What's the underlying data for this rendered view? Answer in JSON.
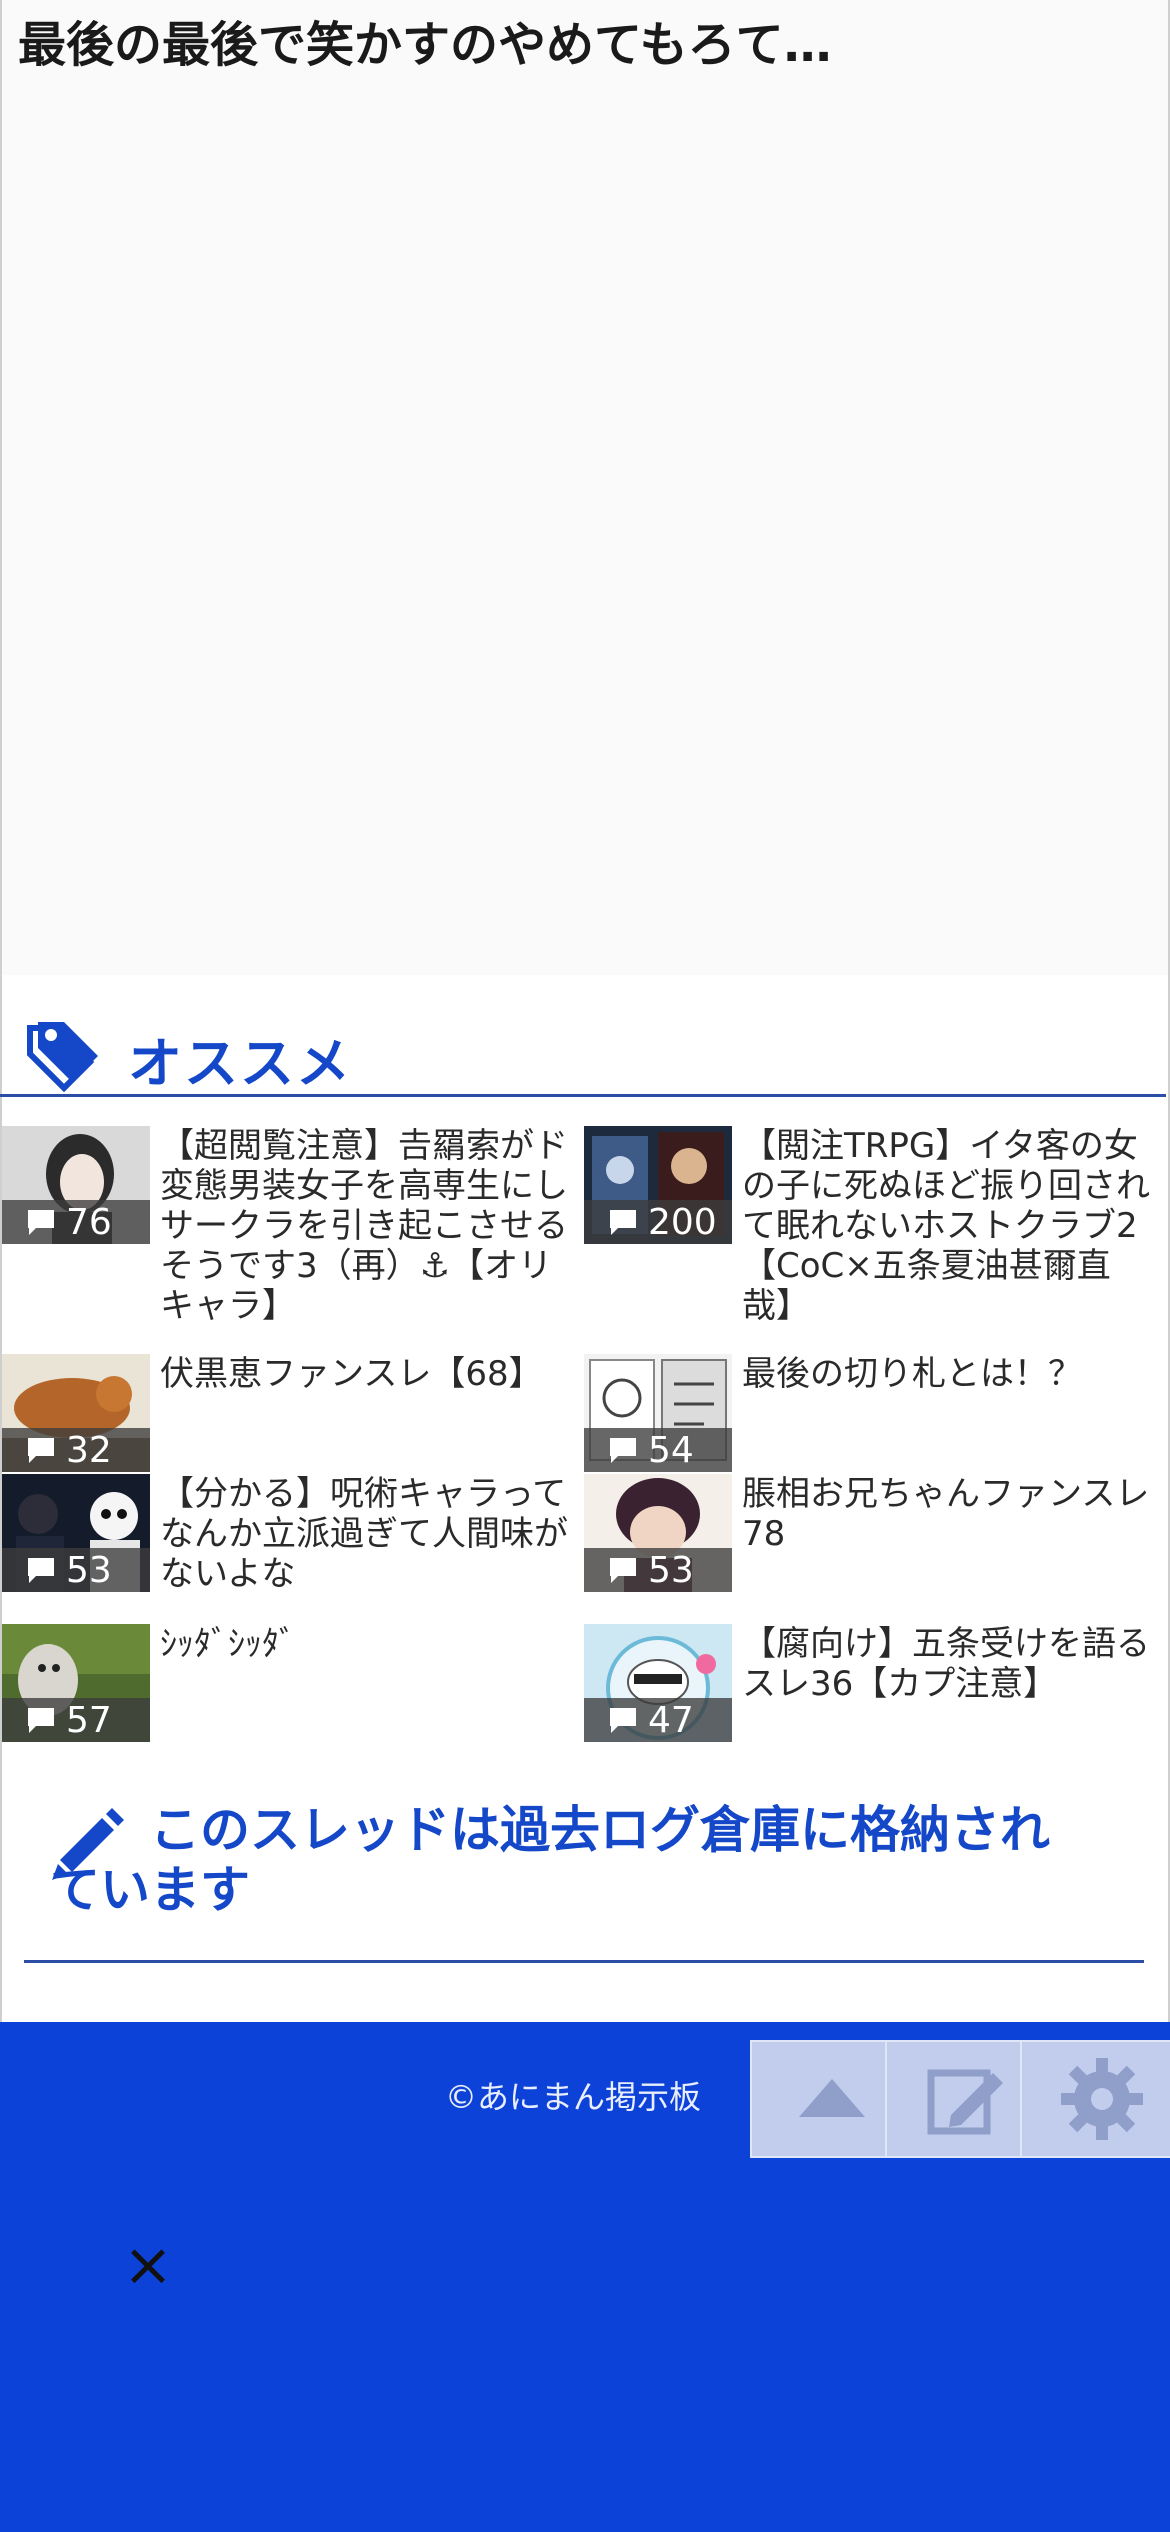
{
  "page": {
    "title": "最後の最後で笑かすのやめてもろて…"
  },
  "recommend": {
    "heading": "オススメ",
    "items": [
      {
        "title": "【超閲覧注意】𠮷羂索がド変態男装女子を高専生にしサークラを引き起こさせるそうです3（再）⚓【オリキャラ】",
        "count": "76"
      },
      {
        "title": "【閲注TRPG】イタ客の女の子に死ぬほど振り回されて眠れないホストクラブ2【CoC×五条夏油甚爾直哉】",
        "count": "200"
      },
      {
        "title": "伏黒恵ファンスレ【68】",
        "count": "32"
      },
      {
        "title": "最後の切り札とは！？",
        "count": "54"
      },
      {
        "title": "【分かる】呪術キャラってなんか立派過ぎて人間味がないよな",
        "count": "53"
      },
      {
        "title": "脹相お兄ちゃんファンスレ78",
        "count": "53"
      },
      {
        "title": "ｼｯﾀﾞｼｯﾀﾞ",
        "count": "57"
      },
      {
        "title": "【腐向け】五条受けを語るスレ36【カプ注意】",
        "count": "47"
      }
    ]
  },
  "archive": {
    "notice": "このスレッドは過去ログ倉庫に格納されています"
  },
  "footer": {
    "copyright": "©あにまん掲示板",
    "close": "×"
  },
  "colors": {
    "accent": "#1448c8",
    "footer_bg": "#0d42d8",
    "button_bg": "#c2cdee"
  }
}
